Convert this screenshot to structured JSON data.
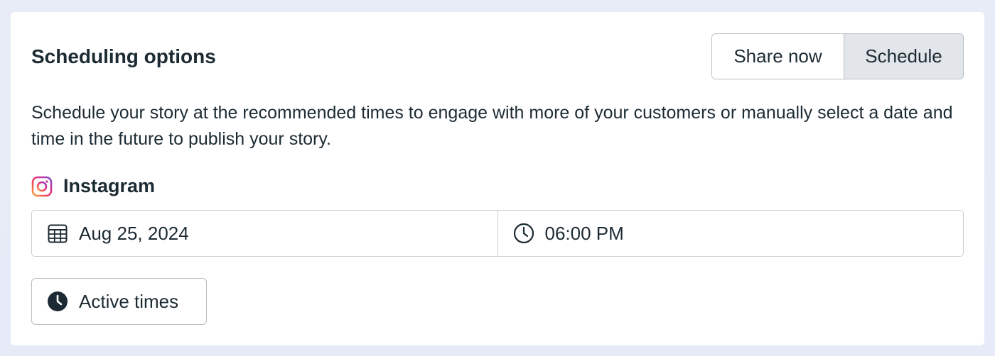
{
  "section": {
    "title": "Scheduling options",
    "description": "Schedule your story at the recommended times to engage with more of your customers or manually select a date and time in the future to publish your story."
  },
  "mode_toggle": {
    "options": [
      "Share now",
      "Schedule"
    ],
    "selected": "Schedule"
  },
  "platform": {
    "name": "Instagram",
    "icon": "instagram-icon"
  },
  "schedule": {
    "date": "Aug 25, 2024",
    "date_icon": "calendar-icon",
    "time": "06:00 PM",
    "time_icon": "clock-icon"
  },
  "active_times": {
    "label": "Active times",
    "icon": "clock-filled-icon"
  },
  "colors": {
    "text": "#1c2b33",
    "selected_segment": "#e2e5e9",
    "border": "#b8bec6"
  }
}
